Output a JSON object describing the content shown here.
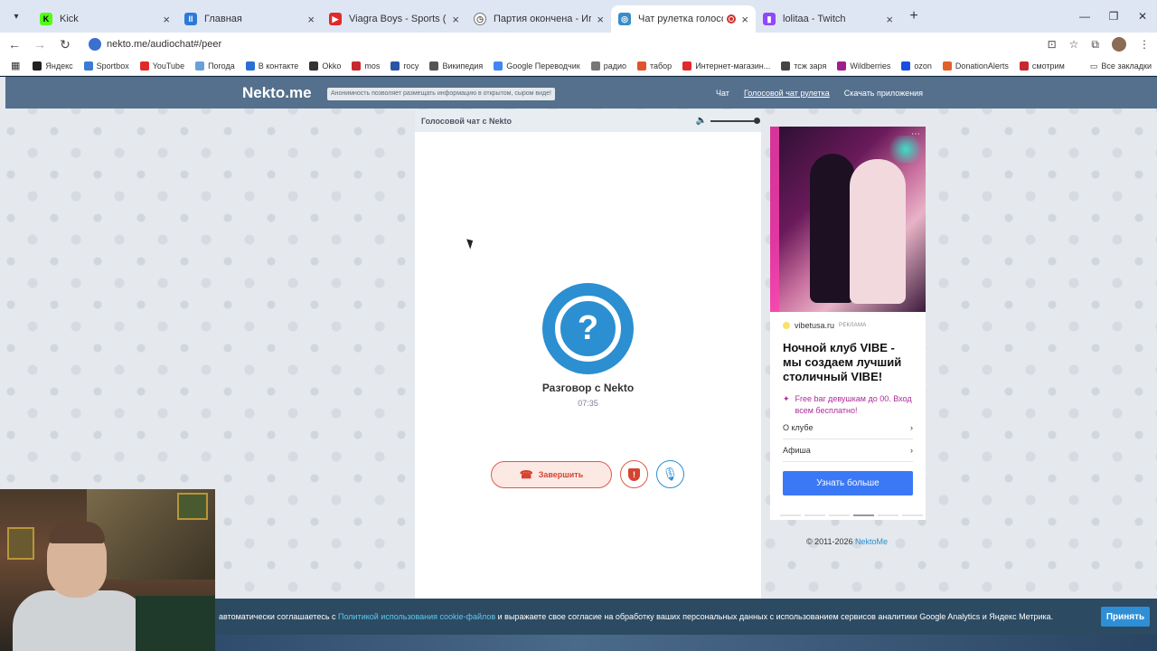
{
  "browser": {
    "tabs": [
      {
        "title": "Kick",
        "fav_color": "#53fc18",
        "fav_letter": "K"
      },
      {
        "title": "Главная",
        "fav_color": "#2d7ad6",
        "fav_letter": "II"
      },
      {
        "title": "Viagra Boys - Sports (Official Vi",
        "fav_color": "#e02a2a",
        "fav_letter": "▶"
      },
      {
        "title": "Партия окончена - Игра molek",
        "fav_color": "#777777",
        "fav_letter": "◷"
      },
      {
        "title": "Чат рулетка голосовая —",
        "fav_color": "#3a8bc8",
        "fav_letter": "◎"
      },
      {
        "title": "lolitaa - Twitch",
        "fav_color": "#9146ff",
        "fav_letter": "▮"
      }
    ],
    "new_tab": "+",
    "url": "nekto.me/audiochat#/peer",
    "bookmarks": [
      {
        "label": "Яндекс",
        "color": "#222222"
      },
      {
        "label": "Sportbox",
        "color": "#3a7bd5"
      },
      {
        "label": "YouTube",
        "color": "#e02a2a"
      },
      {
        "label": "Погода",
        "color": "#6aa0d8"
      },
      {
        "label": "В контакте",
        "color": "#2a6fd6"
      },
      {
        "label": "Okko",
        "color": "#333333"
      },
      {
        "label": "mos",
        "color": "#c8282e"
      },
      {
        "label": "госу",
        "color": "#2a55a6"
      },
      {
        "label": "Википедия",
        "color": "#555555"
      },
      {
        "label": "Google Переводчик",
        "color": "#4285f4"
      },
      {
        "label": "радио",
        "color": "#777777"
      },
      {
        "label": "табор",
        "color": "#e0542a"
      },
      {
        "label": "Интернет-магазин...",
        "color": "#e22a2a"
      },
      {
        "label": "тсж заря",
        "color": "#444444"
      },
      {
        "label": "Wildberries",
        "color": "#a11c8c"
      },
      {
        "label": "ozon",
        "color": "#1a4ee0"
      },
      {
        "label": "DonationAlerts",
        "color": "#e0622a"
      },
      {
        "label": "смотрим",
        "color": "#c8282e"
      }
    ],
    "bookmarks_all": "Все закладки"
  },
  "site": {
    "logo": "Nekto.me",
    "anon_note": "Анонимность позволяет размещать информацию в открытом, сыром виде!",
    "nav": [
      "Чат",
      "Голосовой чат рулетка",
      "Скачать приложения"
    ]
  },
  "chat": {
    "header": "Голосовой чат с Nekto",
    "avatar_symbol": "?",
    "peer_name": "Разговор с Nekto",
    "timer": "07:35",
    "end_label": "Завершить",
    "report_symbol": "!",
    "volume_level": 1.0
  },
  "ad": {
    "domain": "vibetusa.ru",
    "ad_tag": "РЕКЛАМА",
    "title": "Ночной клуб VIBE - мы создаем лучший столичный VIBE!",
    "promo": "Free bar девушкам до 00. Вход всем бесплатно!",
    "links": [
      "О клубе",
      "Афиша"
    ],
    "cta": "Узнать больше",
    "more": "⋯"
  },
  "footer": {
    "copyright_prefix": "© 2011-2026",
    "copyright_link": "NektoMe"
  },
  "cookie": {
    "text_before": "автоматически соглашаетесь с",
    "link": "Политикой использования cookie-файлов",
    "text_after": "и выражаете свое согласие на обработку ваших персональных данных с использованием сервисов аналитики Google Analytics и Яндекс Метрика.",
    "accept": "Принять"
  }
}
